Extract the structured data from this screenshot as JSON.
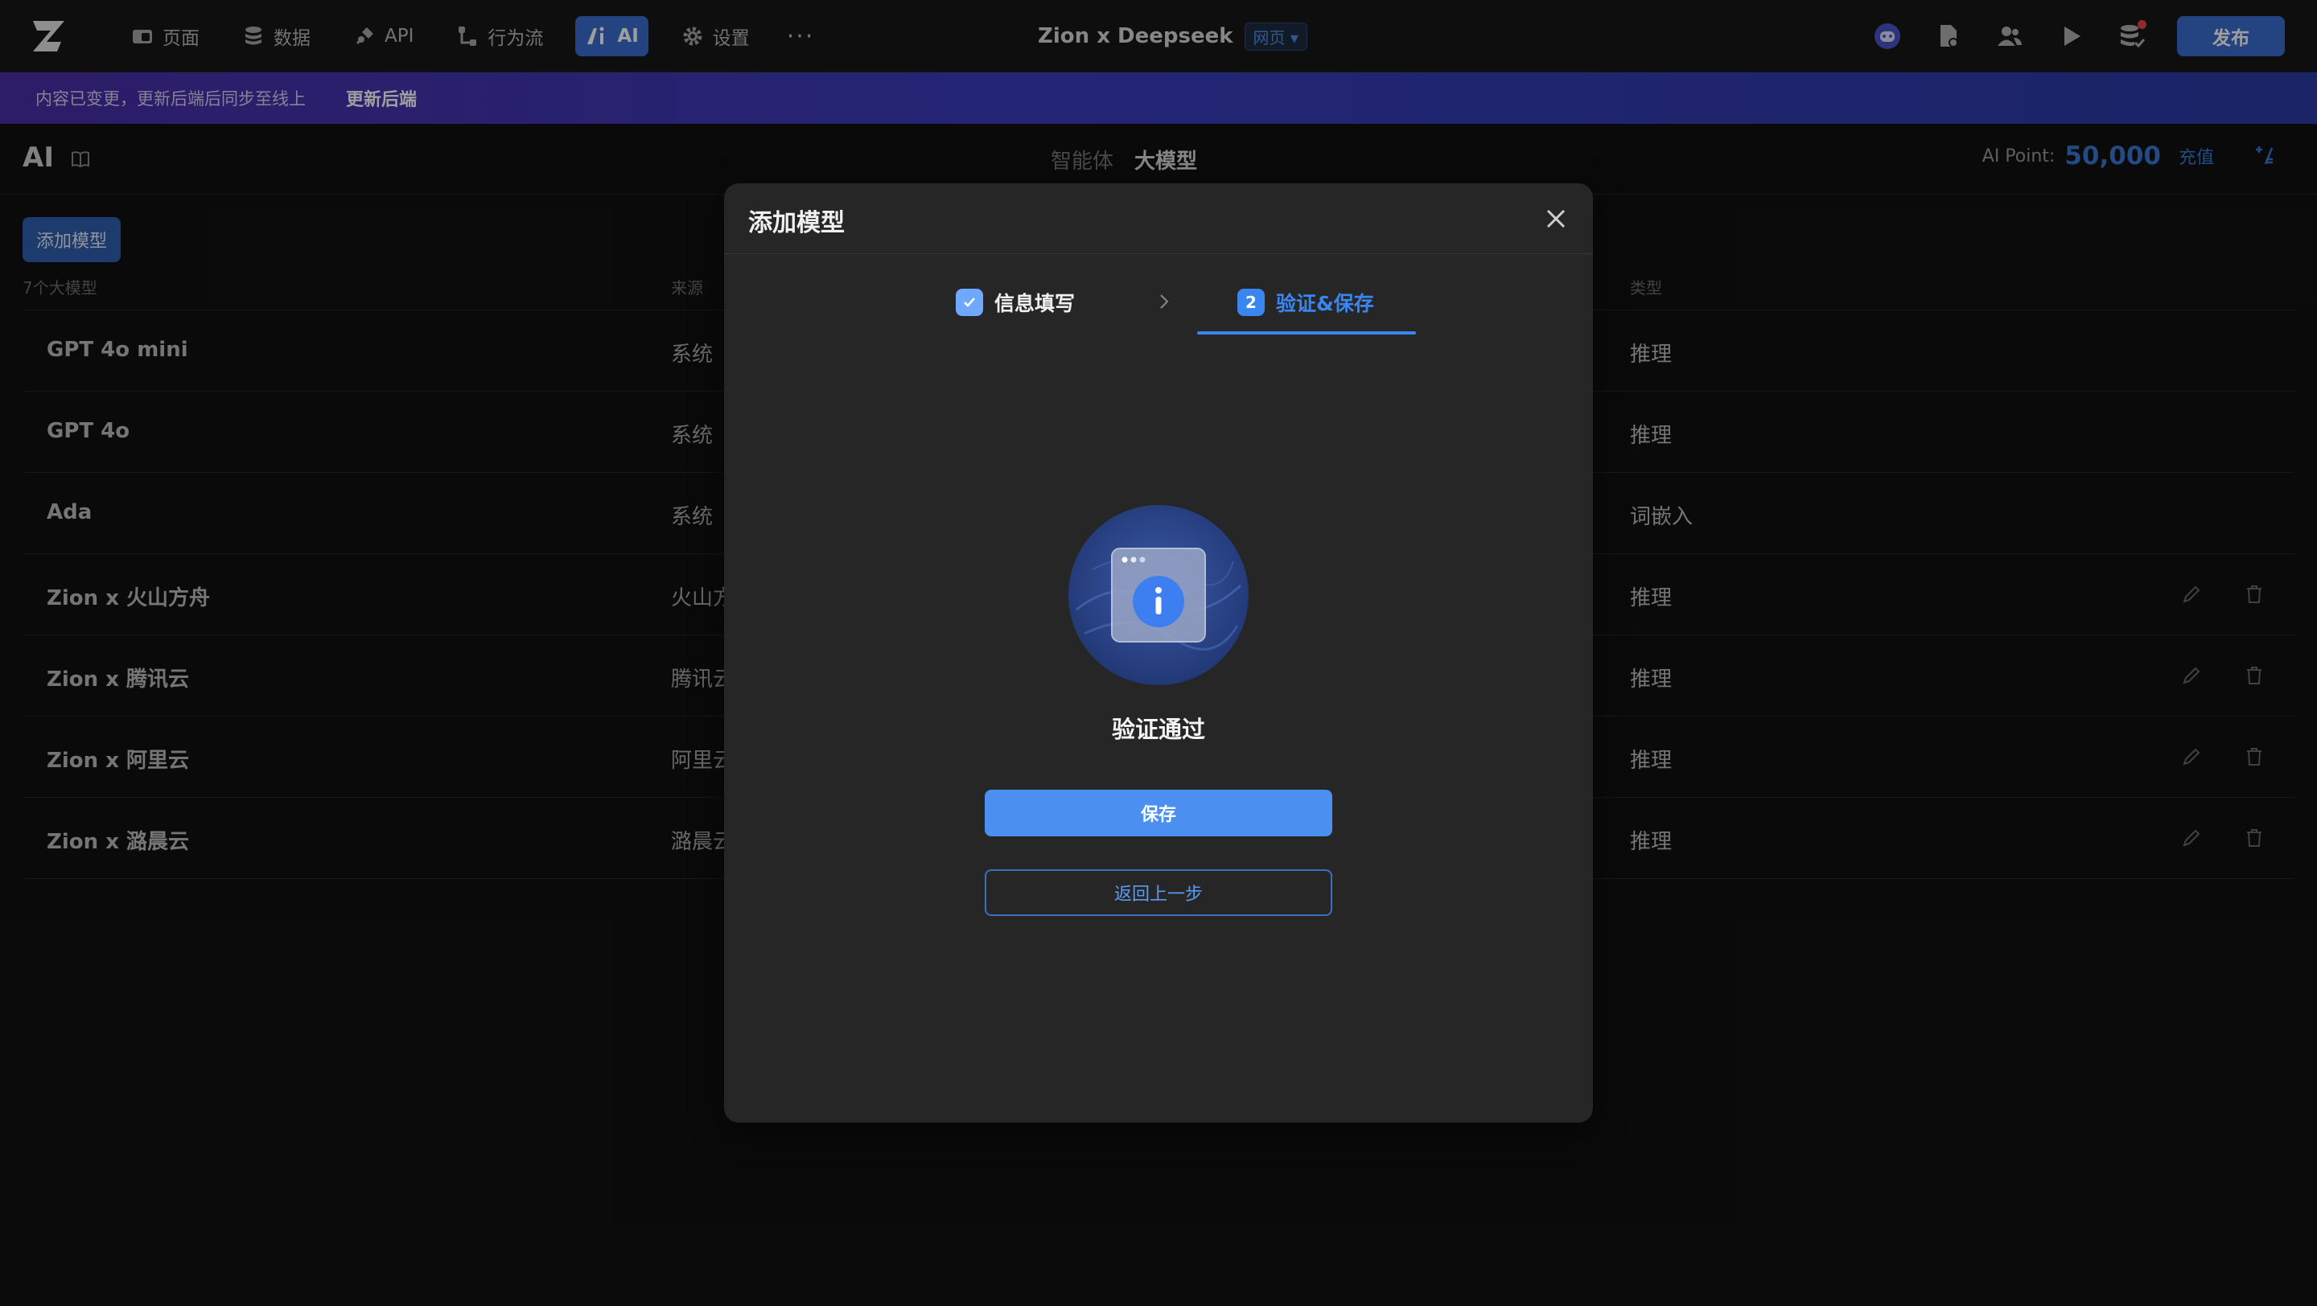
{
  "nav": {
    "items": [
      {
        "label": "页面",
        "icon": "page-icon"
      },
      {
        "label": "数据",
        "icon": "database-icon"
      },
      {
        "label": "API",
        "icon": "api-plug-icon"
      },
      {
        "label": "行为流",
        "icon": "flow-icon"
      },
      {
        "label": "AI",
        "icon": "ai-icon",
        "active": true
      },
      {
        "label": "设置",
        "icon": "gear-icon"
      }
    ],
    "more": "···"
  },
  "project": {
    "name": "Zion x Deepseek",
    "tag": "网页"
  },
  "toolbar": {
    "publish_label": "发布"
  },
  "banner": {
    "text": "内容已变更，更新后端后同步至线上",
    "link": "更新后端"
  },
  "page": {
    "title": "AI",
    "tabs": [
      "智能体",
      "大模型"
    ],
    "active_tab": "大模型",
    "ai_point_label": "AI Point:",
    "ai_point_value": "50,000",
    "recharge_label": "充值"
  },
  "models": {
    "add_button": "添加模型",
    "count": "7个大模型",
    "columns": {
      "source": "来源",
      "type": "类型"
    },
    "rows": [
      {
        "name": "GPT 4o mini",
        "source": "系统",
        "type": "推理",
        "editable": false
      },
      {
        "name": "GPT 4o",
        "source": "系统",
        "type": "推理",
        "editable": false
      },
      {
        "name": "Ada",
        "source": "系统",
        "type": "词嵌入",
        "editable": false
      },
      {
        "name": "Zion x 火山方舟",
        "source": "火山方舟",
        "type": "推理",
        "editable": true
      },
      {
        "name": "Zion x 腾讯云",
        "source": "腾讯云",
        "type": "推理",
        "editable": true
      },
      {
        "name": "Zion x 阿里云",
        "source": "阿里云",
        "type": "推理",
        "editable": true
      },
      {
        "name": "Zion x 潞晨云",
        "source": "潞晨云",
        "type": "推理",
        "editable": true
      }
    ]
  },
  "modal": {
    "title": "添加模型",
    "steps": [
      {
        "label": "信息填写",
        "status": "done"
      },
      {
        "label": "验证&保存",
        "number": "2",
        "status": "active"
      }
    ],
    "result_text": "验证通过",
    "save_label": "保存",
    "back_label": "返回上一步"
  },
  "colors": {
    "accent": "#3a86f0",
    "banner": "#3a3dbd",
    "background": "#111111",
    "modal": "#262626"
  }
}
